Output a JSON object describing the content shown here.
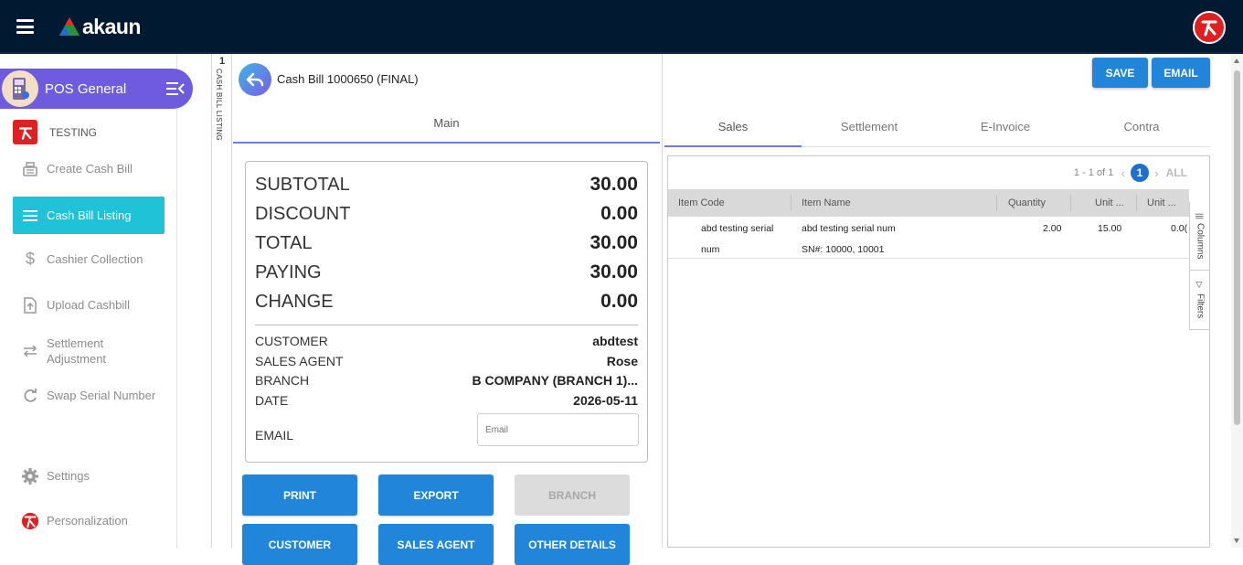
{
  "app": {
    "logo_text": "akaun"
  },
  "sidebar": {
    "module_title": "POS General",
    "company": "TESTING",
    "items": [
      {
        "label": "Create Cash Bill",
        "icon": "cash-register-icon"
      },
      {
        "label": "Cash Bill Listing",
        "icon": "list-icon",
        "active": true
      },
      {
        "label": "Cashier Collection",
        "icon": "dollar-icon"
      },
      {
        "label": "Upload Cashbill",
        "icon": "upload-icon"
      },
      {
        "label": "Settlement Adjustment",
        "icon": "swap-arrows-icon"
      },
      {
        "label": "Swap Serial Number",
        "icon": "refresh-icon"
      },
      {
        "label": "Settings",
        "icon": "gear-icon"
      },
      {
        "label": "Personalization",
        "icon": "akaun-avatar-icon"
      }
    ]
  },
  "listing_strip": {
    "count": "1",
    "label": "CASH BILL LISTING"
  },
  "bill": {
    "title": "Cash Bill 1000650 (FINAL)",
    "tab": "Main",
    "summary": [
      {
        "label": "SUBTOTAL",
        "value": "30.00"
      },
      {
        "label": "DISCOUNT",
        "value": "0.00"
      },
      {
        "label": "TOTAL",
        "value": "30.00"
      },
      {
        "label": "PAYING",
        "value": "30.00"
      },
      {
        "label": "CHANGE",
        "value": "0.00"
      }
    ],
    "info": [
      {
        "label": "CUSTOMER",
        "value": "abdtest"
      },
      {
        "label": "SALES AGENT",
        "value": "Rose"
      },
      {
        "label": "BRANCH",
        "value": "B COMPANY (BRANCH 1)..."
      },
      {
        "label": "DATE",
        "value": "2026-05-11"
      }
    ],
    "email_label": "EMAIL",
    "email_placeholder": "Email",
    "buttons": [
      "PRINT",
      "EXPORT",
      "BRANCH",
      "CUSTOMER",
      "SALES AGENT",
      "OTHER DETAILS"
    ]
  },
  "right": {
    "save_label": "SAVE",
    "email_label": "EMAIL",
    "tabs": [
      "Sales",
      "Settlement",
      "E-Invoice",
      "Contra"
    ],
    "pager": {
      "range": "1 - 1 of 1",
      "page": "1",
      "all": "ALL"
    },
    "columns": [
      "Item Code",
      "Item Name",
      "Quantity",
      "Unit ...",
      "Unit ..."
    ],
    "rows": [
      {
        "code_line1": "abd testing serial",
        "code_line2": "num",
        "name_line1": "abd testing serial num",
        "name_line2": "SN#: 10000, 10001",
        "quantity": "2.00",
        "unit1": "15.00",
        "unit2": "0.0("
      }
    ],
    "side_tools": [
      "Columns",
      "Filters"
    ]
  }
}
